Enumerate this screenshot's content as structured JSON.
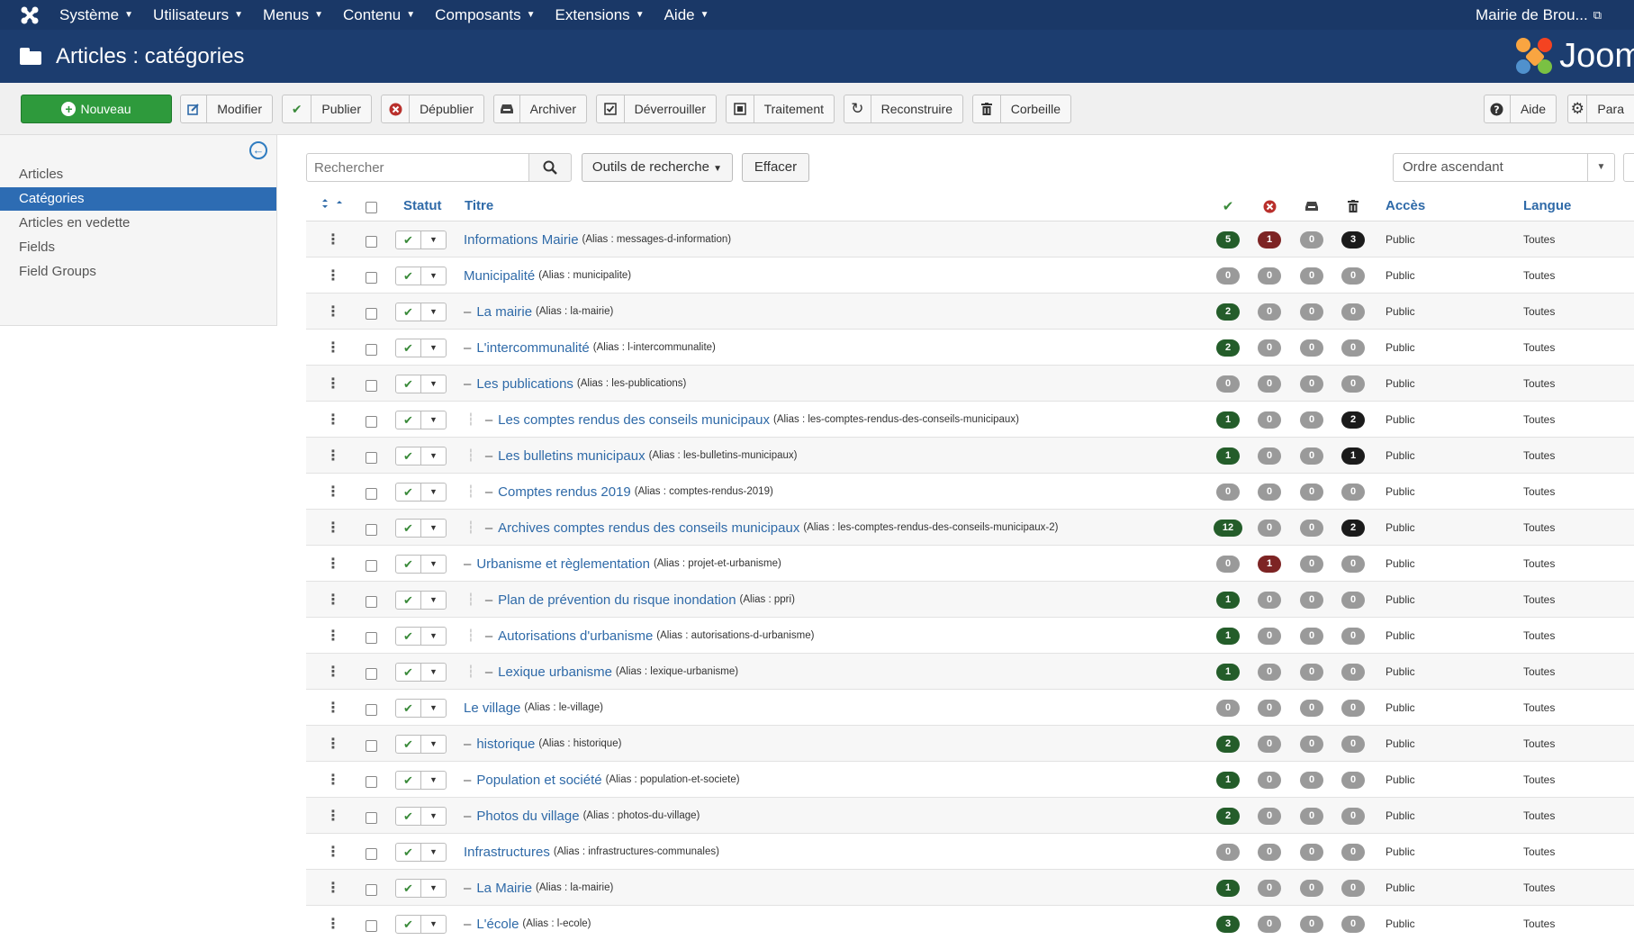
{
  "navbar": {
    "menus": [
      {
        "label": "Système"
      },
      {
        "label": "Utilisateurs"
      },
      {
        "label": "Menus"
      },
      {
        "label": "Contenu"
      },
      {
        "label": "Composants"
      },
      {
        "label": "Extensions"
      },
      {
        "label": "Aide"
      }
    ],
    "site_name": "Mairie de Brou..."
  },
  "header": {
    "title": "Articles : catégories",
    "brand": "Joom"
  },
  "toolbar": {
    "new_label": "Nouveau",
    "buttons": [
      {
        "label": "Modifier",
        "icon": "edit-icon"
      },
      {
        "label": "Publier",
        "icon": "check-icon"
      },
      {
        "label": "Dépublier",
        "icon": "unpublish-icon"
      },
      {
        "label": "Archiver",
        "icon": "archive-icon"
      },
      {
        "label": "Déverrouiller",
        "icon": "checkbox-icon"
      },
      {
        "label": "Traitement",
        "icon": "batch-icon"
      },
      {
        "label": "Reconstruire",
        "icon": "refresh-icon"
      },
      {
        "label": "Corbeille",
        "icon": "trash-icon"
      }
    ],
    "help_label": "Aide",
    "options_label": "Para"
  },
  "sidebar": {
    "items": [
      {
        "label": "Articles",
        "active": false
      },
      {
        "label": "Catégories",
        "active": true
      },
      {
        "label": "Articles en vedette",
        "active": false
      },
      {
        "label": "Fields",
        "active": false
      },
      {
        "label": "Field Groups",
        "active": false
      }
    ]
  },
  "filters": {
    "search_placeholder": "Rechercher",
    "search_tools_label": "Outils de recherche",
    "clear_label": "Effacer",
    "sort_value": "Ordre ascendant"
  },
  "table": {
    "headers": {
      "status": "Statut",
      "title": "Titre",
      "access": "Accès",
      "language": "Langue"
    },
    "rows": [
      {
        "level": 1,
        "title": "Informations Mairie",
        "alias": "(Alias : messages-d-information)",
        "published": "5",
        "unpublished": "1",
        "archived": "0",
        "trashed": "3",
        "access": "Public",
        "language": "Toutes"
      },
      {
        "level": 1,
        "title": "Municipalité",
        "alias": "(Alias : municipalite)",
        "published": "0",
        "unpublished": "0",
        "archived": "0",
        "trashed": "0",
        "access": "Public",
        "language": "Toutes"
      },
      {
        "level": 2,
        "title": "La mairie",
        "alias": "(Alias : la-mairie)",
        "published": "2",
        "unpublished": "0",
        "archived": "0",
        "trashed": "0",
        "access": "Public",
        "language": "Toutes"
      },
      {
        "level": 2,
        "title": "L'intercommunalité",
        "alias": "(Alias : l-intercommunalite)",
        "published": "2",
        "unpublished": "0",
        "archived": "0",
        "trashed": "0",
        "access": "Public",
        "language": "Toutes"
      },
      {
        "level": 2,
        "title": "Les publications",
        "alias": "(Alias : les-publications)",
        "published": "0",
        "unpublished": "0",
        "archived": "0",
        "trashed": "0",
        "access": "Public",
        "language": "Toutes"
      },
      {
        "level": 3,
        "title": "Les comptes rendus des conseils municipaux",
        "alias": "(Alias : les-comptes-rendus-des-conseils-municipaux)",
        "published": "1",
        "unpublished": "0",
        "archived": "0",
        "trashed": "2",
        "access": "Public",
        "language": "Toutes"
      },
      {
        "level": 3,
        "title": "Les bulletins municipaux",
        "alias": "(Alias : les-bulletins-municipaux)",
        "published": "1",
        "unpublished": "0",
        "archived": "0",
        "trashed": "1",
        "access": "Public",
        "language": "Toutes"
      },
      {
        "level": 3,
        "title": "Comptes rendus 2019",
        "alias": "(Alias : comptes-rendus-2019)",
        "published": "0",
        "unpublished": "0",
        "archived": "0",
        "trashed": "0",
        "access": "Public",
        "language": "Toutes"
      },
      {
        "level": 3,
        "title": "Archives comptes rendus des conseils municipaux",
        "alias": "(Alias : les-comptes-rendus-des-conseils-municipaux-2)",
        "published": "12",
        "unpublished": "0",
        "archived": "0",
        "trashed": "2",
        "access": "Public",
        "language": "Toutes"
      },
      {
        "level": 2,
        "title": "Urbanisme et règlementation",
        "alias": "(Alias : projet-et-urbanisme)",
        "published": "0",
        "unpublished": "1",
        "archived": "0",
        "trashed": "0",
        "access": "Public",
        "language": "Toutes"
      },
      {
        "level": 3,
        "title": "Plan de prévention du risque inondation",
        "alias": "(Alias : ppri)",
        "published": "1",
        "unpublished": "0",
        "archived": "0",
        "trashed": "0",
        "access": "Public",
        "language": "Toutes"
      },
      {
        "level": 3,
        "title": "Autorisations d'urbanisme",
        "alias": "(Alias : autorisations-d-urbanisme)",
        "published": "1",
        "unpublished": "0",
        "archived": "0",
        "trashed": "0",
        "access": "Public",
        "language": "Toutes"
      },
      {
        "level": 3,
        "title": "Lexique urbanisme",
        "alias": "(Alias : lexique-urbanisme)",
        "published": "1",
        "unpublished": "0",
        "archived": "0",
        "trashed": "0",
        "access": "Public",
        "language": "Toutes"
      },
      {
        "level": 1,
        "title": "Le village",
        "alias": "(Alias : le-village)",
        "published": "0",
        "unpublished": "0",
        "archived": "0",
        "trashed": "0",
        "access": "Public",
        "language": "Toutes"
      },
      {
        "level": 2,
        "title": "historique",
        "alias": "(Alias : historique)",
        "published": "2",
        "unpublished": "0",
        "archived": "0",
        "trashed": "0",
        "access": "Public",
        "language": "Toutes"
      },
      {
        "level": 2,
        "title": "Population et société",
        "alias": "(Alias : population-et-societe)",
        "published": "1",
        "unpublished": "0",
        "archived": "0",
        "trashed": "0",
        "access": "Public",
        "language": "Toutes"
      },
      {
        "level": 2,
        "title": "Photos du village",
        "alias": "(Alias : photos-du-village)",
        "published": "2",
        "unpublished": "0",
        "archived": "0",
        "trashed": "0",
        "access": "Public",
        "language": "Toutes"
      },
      {
        "level": 1,
        "title": "Infrastructures",
        "alias": "(Alias : infrastructures-communales)",
        "published": "0",
        "unpublished": "0",
        "archived": "0",
        "trashed": "0",
        "access": "Public",
        "language": "Toutes"
      },
      {
        "level": 2,
        "title": "La Mairie",
        "alias": "(Alias : la-mairie)",
        "published": "1",
        "unpublished": "0",
        "archived": "0",
        "trashed": "0",
        "access": "Public",
        "language": "Toutes"
      },
      {
        "level": 2,
        "title": "L'école",
        "alias": "(Alias : l-ecole)",
        "published": "3",
        "unpublished": "0",
        "archived": "0",
        "trashed": "0",
        "access": "Public",
        "language": "Toutes"
      }
    ]
  },
  "colors": {
    "navbar": "#1a3867",
    "header": "#1c3d6f",
    "primary_button": "#2e9a3c",
    "link": "#2f6aa8",
    "published_badge": "#245d2a",
    "unpublished_badge": "#7d2424",
    "trashed_badge": "#1b1b1b",
    "zero_badge": "#9a9a9a"
  }
}
